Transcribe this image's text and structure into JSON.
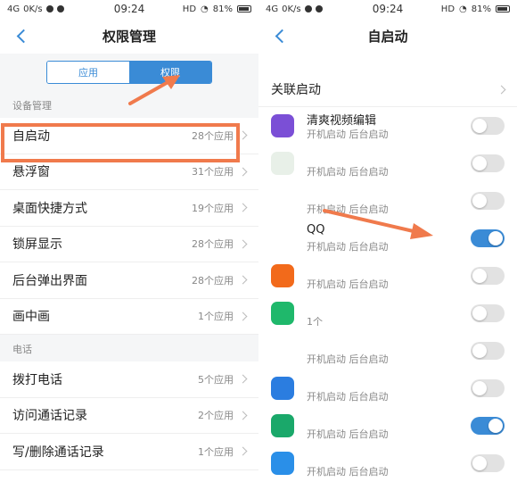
{
  "left": {
    "status": {
      "signal": "4G",
      "speed": "0K/s",
      "time": "09:24",
      "hd": "HD",
      "battery": "81%"
    },
    "title": "权限管理",
    "tabs": [
      {
        "label": "应用",
        "active": false
      },
      {
        "label": "权限",
        "active": true
      }
    ],
    "sections": [
      {
        "header": "设备管理",
        "rows": [
          {
            "label": "自启动",
            "count": "28个应用"
          },
          {
            "label": "悬浮窗",
            "count": "31个应用"
          },
          {
            "label": "桌面快捷方式",
            "count": "19个应用"
          },
          {
            "label": "锁屏显示",
            "count": "28个应用"
          },
          {
            "label": "后台弹出界面",
            "count": "28个应用"
          },
          {
            "label": "画中画",
            "count": "1个应用"
          }
        ]
      },
      {
        "header": "电话",
        "rows": [
          {
            "label": "拨打电话",
            "count": "5个应用"
          },
          {
            "label": "访问通话记录",
            "count": "2个应用"
          },
          {
            "label": "写/删除通话记录",
            "count": "1个应用"
          }
        ]
      }
    ]
  },
  "right": {
    "status": {
      "signal": "4G",
      "speed": "0K/s",
      "time": "09:24",
      "hd": "HD",
      "battery": "81%"
    },
    "title": "自启动",
    "linked_label": "关联启动",
    "apps": [
      {
        "name": "清爽视频编辑",
        "sub": "开机启动  后台启动",
        "on": false,
        "icon_color": "#7b4fd6"
      },
      {
        "name": "",
        "sub": "开机启动  后台启动",
        "on": false,
        "icon_color": "#e8f0e8"
      },
      {
        "name": "",
        "sub": "开机启动  后台启动",
        "on": false,
        "icon_color": "#ffffff"
      },
      {
        "name": "QQ",
        "sub": "开机启动  后台启动",
        "on": true,
        "icon_color": "#ffffff"
      },
      {
        "name": "",
        "sub": "开机启动  后台启动",
        "on": false,
        "icon_color": "#f26a1b"
      },
      {
        "name": "",
        "sub": "1个",
        "on": false,
        "icon_color": "#1fb86b"
      },
      {
        "name": "",
        "sub": "开机启动  后台启动",
        "on": false,
        "icon_color": "#ffffff"
      },
      {
        "name": "",
        "sub": "开机启动  后台启动",
        "on": false,
        "icon_color": "#2b7de0"
      },
      {
        "name": "",
        "sub": "开机启动  后台启动",
        "on": true,
        "icon_color": "#1aa86a"
      },
      {
        "name": "",
        "sub": "开机启动  后台启动",
        "on": false,
        "icon_color": "#2a8fe8"
      }
    ]
  }
}
